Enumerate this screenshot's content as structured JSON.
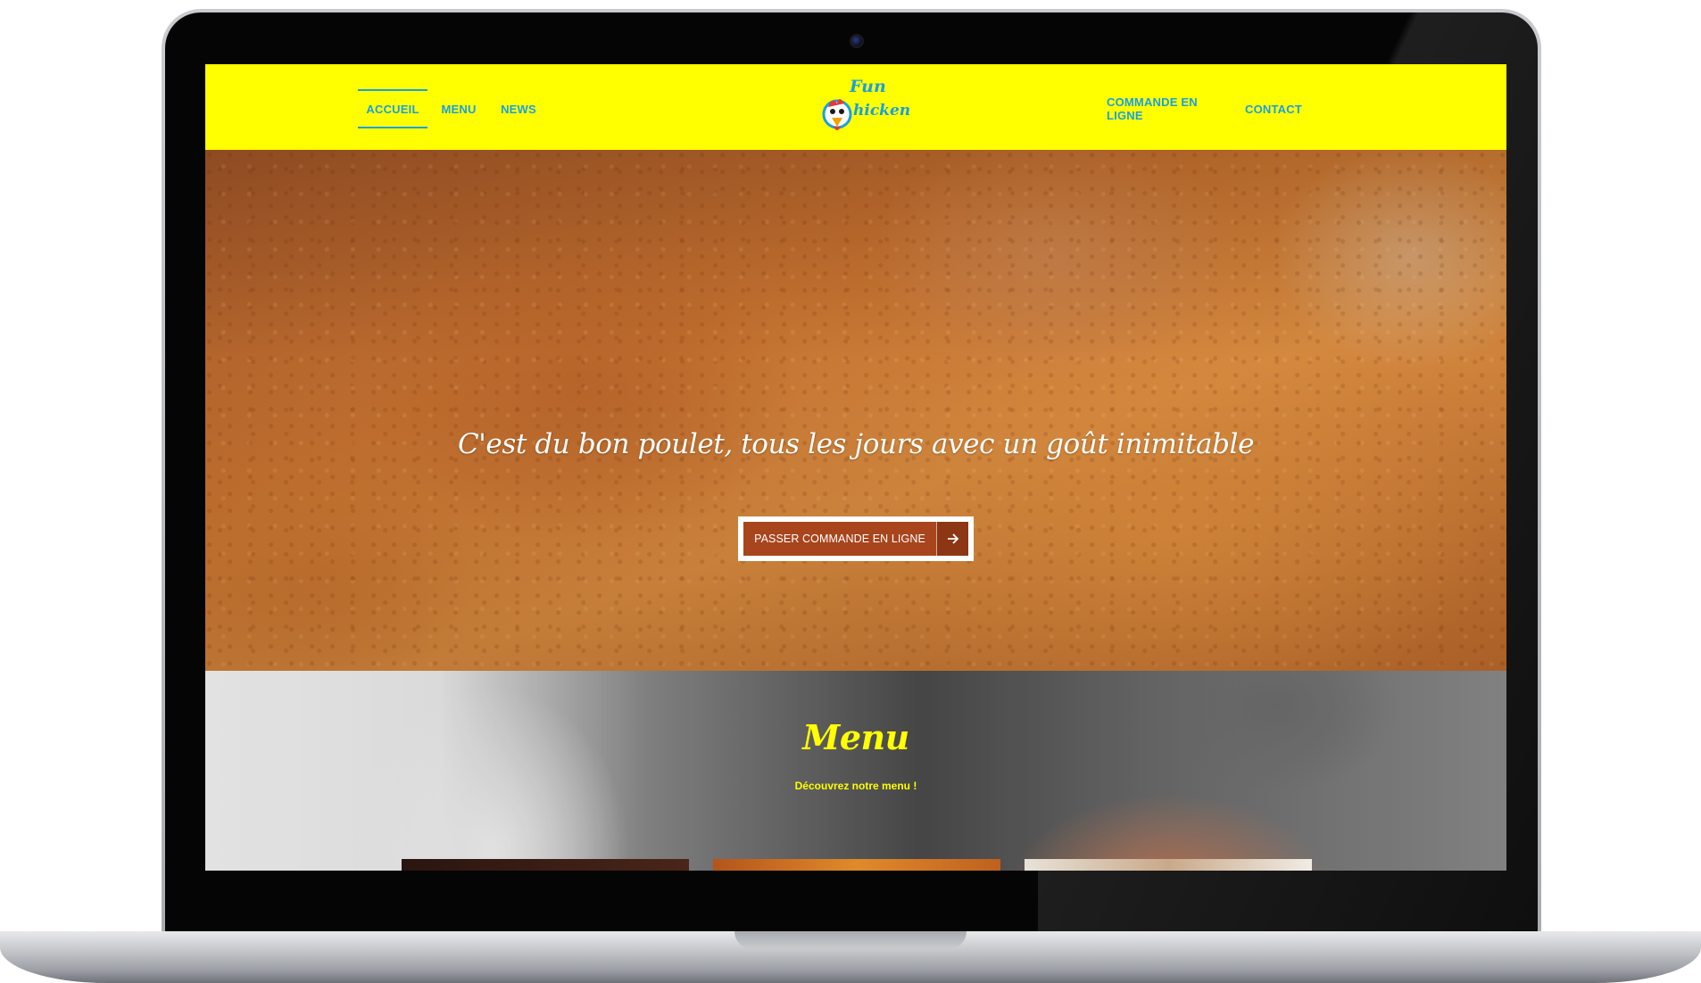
{
  "nav": {
    "left_items": [
      {
        "label": "ACCUEIL",
        "active": true
      },
      {
        "label": "MENU",
        "active": false
      },
      {
        "label": "NEWS",
        "active": false
      }
    ],
    "right_items": [
      {
        "label": "COMMANDE EN LIGNE",
        "active": false
      },
      {
        "label": "CONTACT",
        "active": false
      }
    ],
    "logo": {
      "name": "Fun Chicken",
      "lines": [
        "Fun",
        "hicken"
      ],
      "icon": "chicken-mascot-icon"
    }
  },
  "hero": {
    "tagline": "C'est du bon poulet, tous les jours avec un goût inimitable",
    "cta_label": "PASSER COMMANDE EN LIGNE",
    "cta_icon": "arrow-right-icon"
  },
  "menu_section": {
    "title": "Menu",
    "subtitle": "Découvrez notre menu !"
  },
  "colors": {
    "nav_background": "#ffff00",
    "nav_link": "#1aa0e0",
    "cta_background": "#a8451d",
    "menu_title": "#ffff00"
  }
}
